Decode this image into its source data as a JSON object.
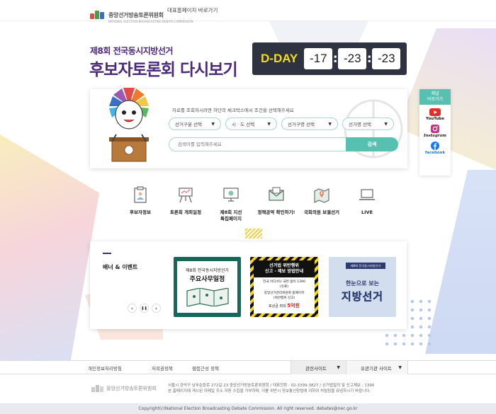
{
  "header": {
    "logo_text": "중앙선거방송토론위원회",
    "logo_subtext": "NATIONAL ELECTION BROADCASTING DEBATE COMMISSION",
    "home_link": "대표홈페이지 바로가기"
  },
  "hero": {
    "subtitle": "제8회 전국동시지방선거",
    "title": "후보자토론회 다시보기"
  },
  "dday": {
    "label": "D-DAY",
    "values": [
      "-17",
      "-23",
      "-23"
    ]
  },
  "search": {
    "hint": "자료를 조회하시려면 하단의 체크박스에서 조건을 선택해주세요",
    "selects": [
      "선거구분 선택",
      "시 · 도 선택",
      "선거구명 선택",
      "선거명 선택"
    ],
    "placeholder": "검색어를 입력해주세요",
    "button": "검색"
  },
  "channel": {
    "title_line1": "채널",
    "title_line2": "바로가기",
    "items": [
      "YouTube",
      "Instagram",
      "facebook"
    ]
  },
  "quick_menu": [
    {
      "label": "후보자정보",
      "icon": "clipboard-person-icon"
    },
    {
      "label": "토론회 개최일정",
      "icon": "podium-board-icon"
    },
    {
      "label": "제8회 지선\n특집페이지",
      "icon": "monitor-icon"
    },
    {
      "label": "정책공약 확인하기!",
      "icon": "envelope-icon"
    },
    {
      "label": "국회의원 보궐선거",
      "icon": "map-pin-icon"
    },
    {
      "label": "LIVE",
      "icon": "laptop-icon"
    }
  ],
  "banners": {
    "title": "배너 & 이벤트",
    "b1": {
      "line1": "제8회 전국동시지방선거",
      "line2": "주요사무일정"
    },
    "b2": {
      "head1": "선거법 위반행위",
      "head2": "신고 · 제보 방법안내",
      "l1": "전국 어디서나 국번 없이 1390",
      "l2": "(유료)",
      "l3": "중앙선거관리위원회 홈페이지",
      "l4": "(위반행위 신고)",
      "prize_label": "포상금 최대",
      "prize_value": "5억원"
    },
    "b3": {
      "tag": "제8회 전국동시지방선거",
      "line1": "한눈으로 보는",
      "line2": "지방선거"
    },
    "controls": [
      "‹",
      "❚❚",
      "›"
    ]
  },
  "footer": {
    "links": [
      "개인정보처리방침",
      "저작권정책",
      "웹접근성 정책"
    ],
    "related_sites": "관련사이트",
    "org_sites": "유관기관 사이트",
    "logo_text": "중앙선거방송토론위원회",
    "address": "서울시 관악구 남부순환로 272길 23 중앙선거방송토론위원회 / 대표전화 : 02-3399-3827 / 선거법질의 및 신고제보 : 1390",
    "notice": "본 홈페이지에 게시된 이메일 주소 자동 수집을 거부하며, 이를 위반시 정보통신망법에 의하여 처벌됨을 유념하시기 바랍니다.",
    "copyright": "Copyright(c)National Election Broadcasting Debate Commission. All right reserved. debates@nec.go.kr"
  },
  "colors": {
    "brand_purple": "#4b2a7a",
    "teal": "#58c0b1",
    "dday_bg": "#2f3341",
    "dday_label": "#f5e000"
  }
}
